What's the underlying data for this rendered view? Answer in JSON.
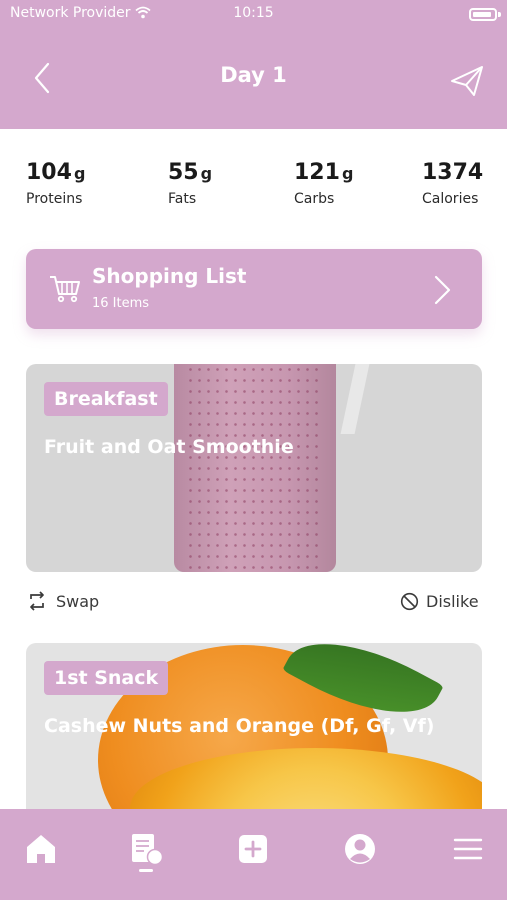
{
  "status_bar": {
    "provider": "Network Provider",
    "time": "10:15"
  },
  "header": {
    "title": "Day 1"
  },
  "stats": [
    {
      "value": "104",
      "unit": "g",
      "label": "Proteins"
    },
    {
      "value": "55",
      "unit": "g",
      "label": "Fats"
    },
    {
      "value": "121",
      "unit": "g",
      "label": "Carbs"
    },
    {
      "value": "1374",
      "unit": "",
      "label": "Calories"
    }
  ],
  "shopping_list": {
    "title": "Shopping List",
    "count": "16 Items"
  },
  "meals": [
    {
      "tag": "Breakfast",
      "title": "Fruit and Oat Smoothie"
    },
    {
      "tag": "1st Snack",
      "title": "Cashew Nuts and Orange (Df, Gf, Vf)"
    }
  ],
  "actions": {
    "swap": "Swap",
    "dislike": "Dislike"
  },
  "colors": {
    "accent": "#d4a8cd",
    "text": "#1f1f1f"
  },
  "tabs": [
    "home-icon",
    "meal-plan-icon",
    "add-icon",
    "profile-icon",
    "menu-icon"
  ]
}
